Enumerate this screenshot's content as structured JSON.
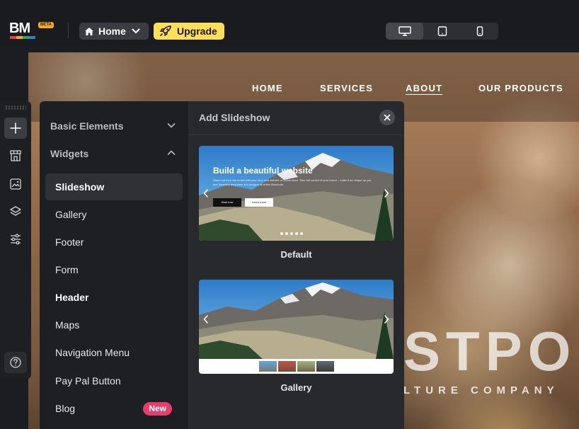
{
  "topbar": {
    "logo": "BM",
    "beta_badge": "BETA",
    "home_label": "Home",
    "upgrade_label": "Upgrade",
    "devices": [
      "desktop-icon",
      "tablet-icon",
      "mobile-icon"
    ],
    "active_device": "desktop"
  },
  "site_nav": {
    "items": [
      "HOME",
      "SERVICES",
      "ABOUT",
      "OUR PRODUCTS"
    ],
    "active": "ABOUT"
  },
  "hero": {
    "big_text": "STPOI",
    "sub_text": "LTURE COMPANY"
  },
  "tools": [
    "plus-icon",
    "store-icon",
    "image-icon",
    "layers-icon",
    "sliders-icon",
    "help-icon"
  ],
  "elements_panel": {
    "sections": [
      {
        "label": "Basic Elements",
        "expanded": false
      },
      {
        "label": "Widgets",
        "expanded": true
      }
    ],
    "widgets": [
      {
        "label": "Slideshow",
        "selected": true
      },
      {
        "label": "Gallery"
      },
      {
        "label": "Footer"
      },
      {
        "label": "Form"
      },
      {
        "label": "Header"
      },
      {
        "label": "Maps"
      },
      {
        "label": "Navigation Menu"
      },
      {
        "label": "Pay Pal Button"
      },
      {
        "label": "Blog",
        "badge": "New"
      }
    ]
  },
  "slideshow_panel": {
    "title": "Add Slideshow",
    "templates": [
      {
        "label": "Default",
        "overlay_title": "Build a beautiful website",
        "overlay_text": "Stand out from the crowd with your very own website or online store. Take full control of your brand – make it as unique as you are! Beautiful templates and designs all within Boxmode.",
        "button1": "Start now",
        "button2": "Learn more"
      },
      {
        "label": "Gallery"
      }
    ]
  },
  "colors": {
    "accent_yellow": "#ffde59",
    "badge_red": "#e53e6b",
    "panel_bg": "#1e1f22",
    "beta_orange": "#f5a623"
  }
}
